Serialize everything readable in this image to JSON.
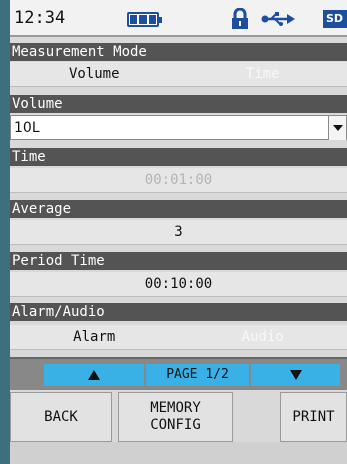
{
  "status": {
    "time": "12:34",
    "icons": [
      "battery-icon",
      "lock-icon",
      "usb-icon",
      "sd-card-icon"
    ],
    "sd_label": "SD"
  },
  "measurement_mode": {
    "label": "Measurement Mode",
    "options": [
      "Volume",
      "Time"
    ],
    "selected": "Volume"
  },
  "volume": {
    "label": "Volume",
    "value": "10L"
  },
  "time": {
    "label": "Time",
    "value": "00:01:00",
    "enabled": false
  },
  "average": {
    "label": "Average",
    "value": "3"
  },
  "period_time": {
    "label": "Period Time",
    "value": "00:10:00"
  },
  "alarm_audio": {
    "label": "Alarm/Audio",
    "options": [
      "Alarm",
      "Audio"
    ],
    "selected": "Alarm"
  },
  "pager": {
    "indicator": "PAGE 1/2"
  },
  "buttons": {
    "back": "BACK",
    "memory_config": "MEMORY\nCONFIG",
    "print": "PRINT"
  },
  "colors": {
    "background": "#3e6f80",
    "header": "#545454",
    "accent": "#3ab1e6",
    "status_blue": "#1d4fa0"
  }
}
